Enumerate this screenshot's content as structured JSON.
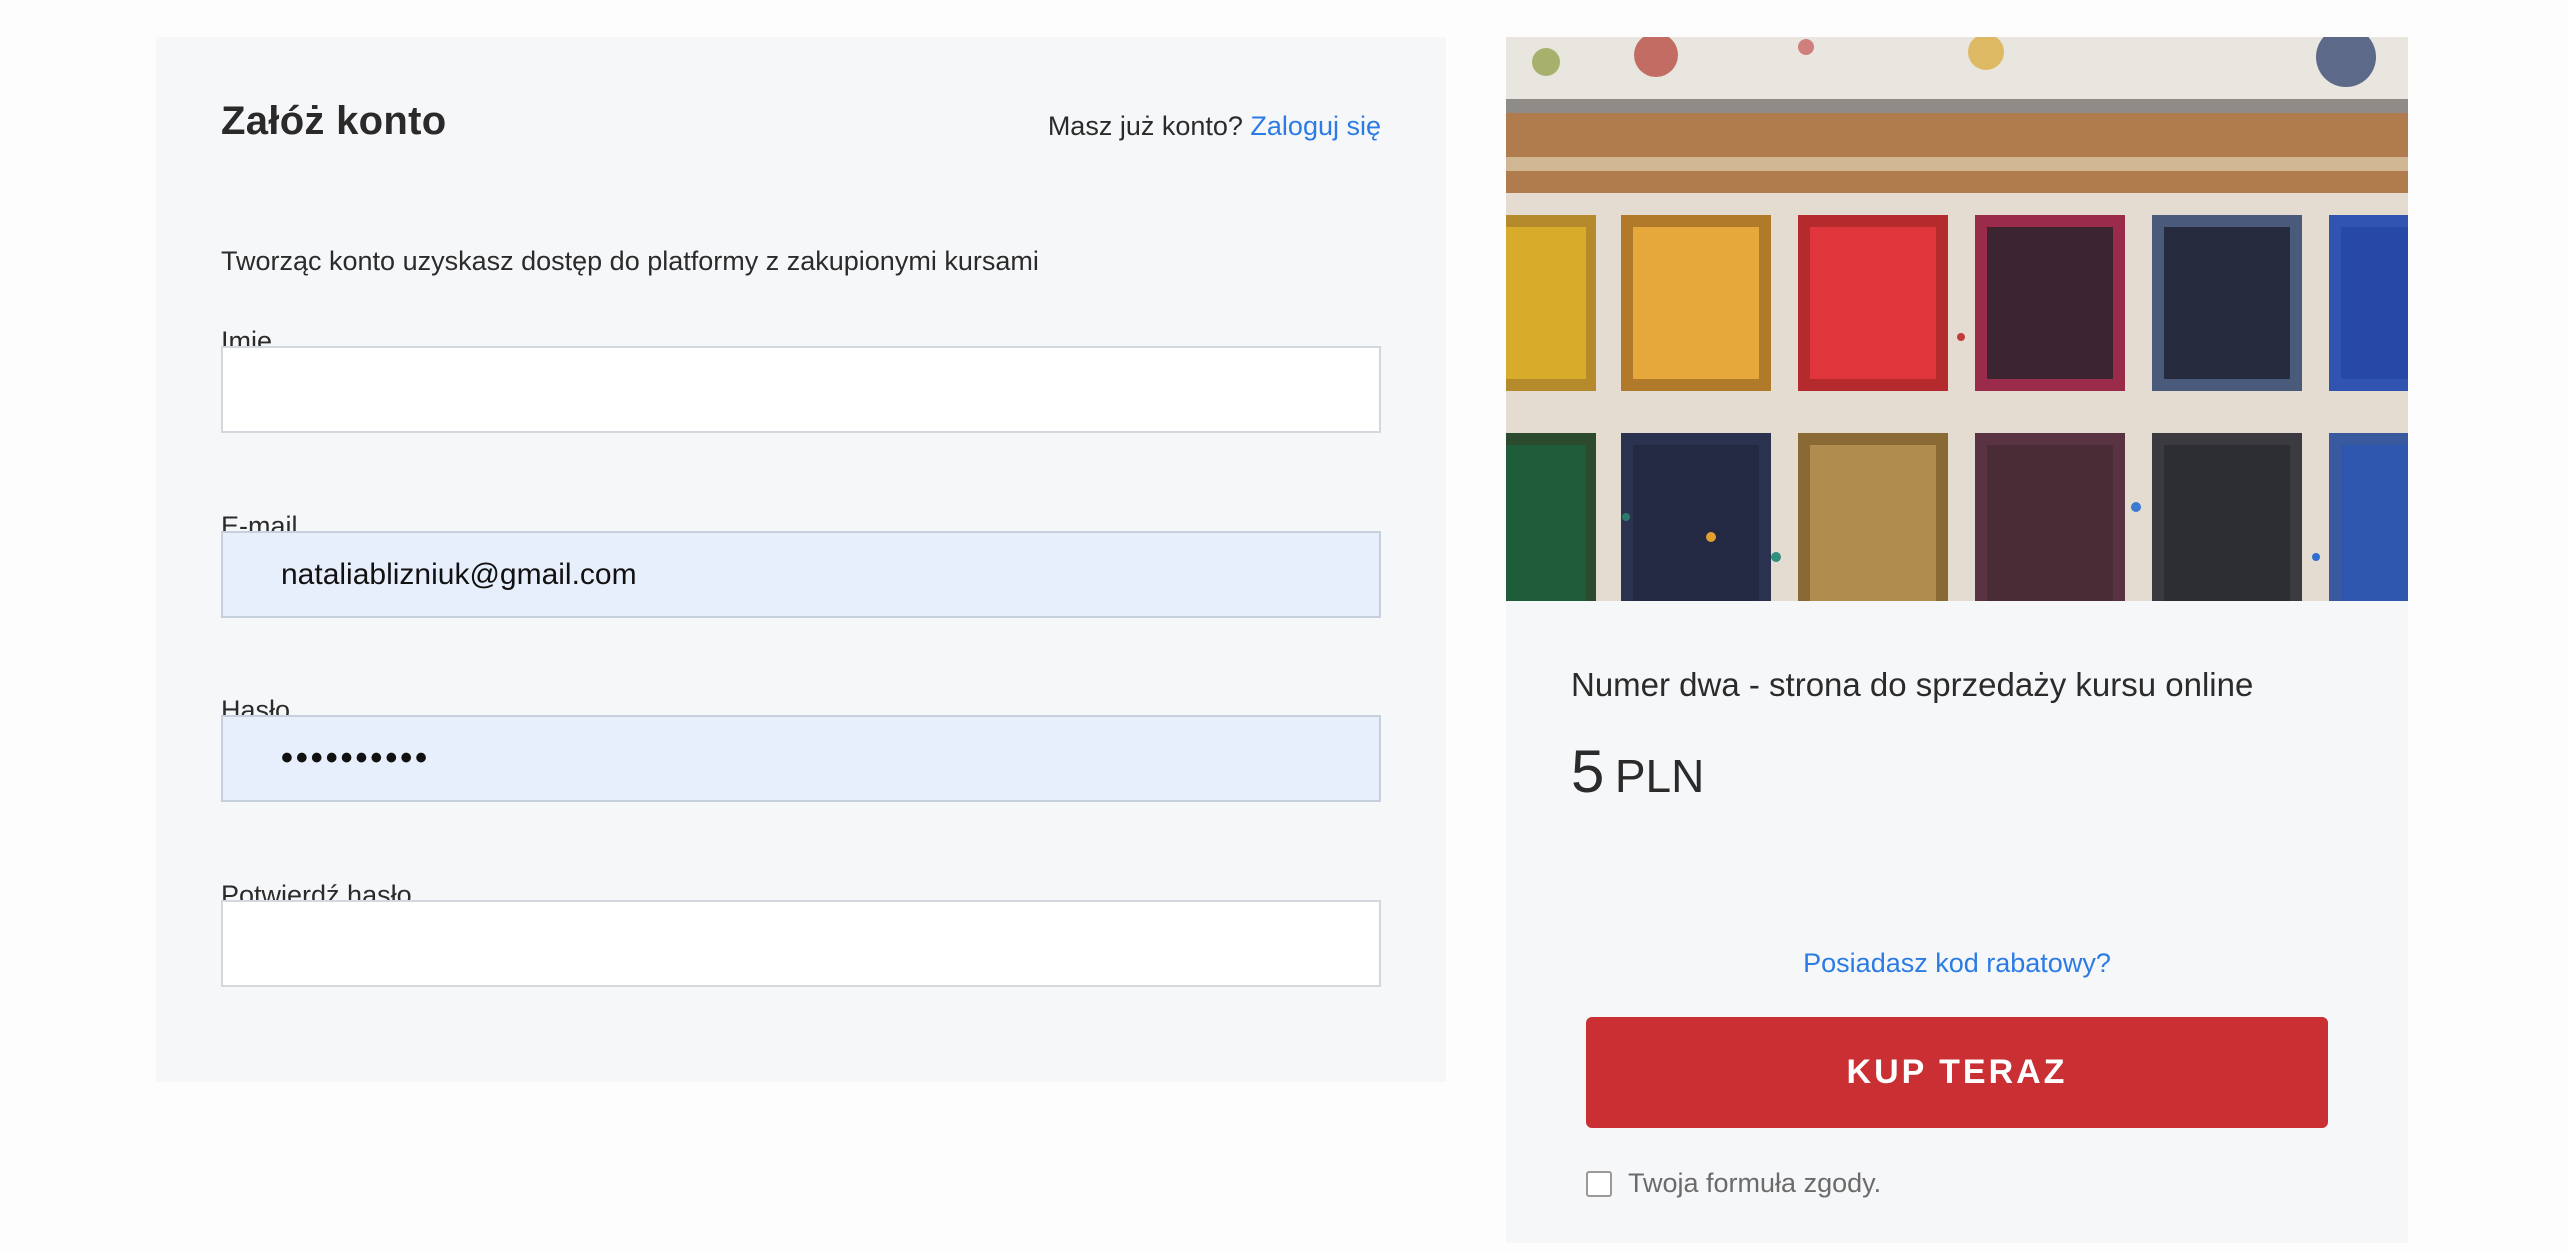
{
  "form": {
    "title": "Załóż konto",
    "login_prompt": "Masz już konto?",
    "login_link": "Zaloguj się",
    "subtitle": "Tworząc konto uzyskasz dostęp do platformy z zakupionymi kursami",
    "fields": {
      "name": {
        "label": "Imię",
        "value": ""
      },
      "email": {
        "label": "E-mail",
        "value": "nataliablizniuk@gmail.com"
      },
      "password": {
        "label": "Hasło",
        "value": "••••••••••"
      },
      "confirm_password": {
        "label": "Potwierdź hasło",
        "value": ""
      }
    }
  },
  "product": {
    "image_icon": "watercolor-palette-image",
    "name": "Numer dwa - strona do sprzedaży kursu online",
    "price_amount": "5",
    "price_currency": "PLN",
    "discount_link": "Posiadasz kod rabatowy?",
    "buy_button": "KUP TERAZ",
    "consent_label": "Twoja formuła zgody.",
    "consent_checked": false
  },
  "colors": {
    "accent_link": "#2c7be5",
    "buy_button": "#c92f33",
    "autofill_bg": "#e8effc",
    "panel_bg": "#f6f7f9"
  }
}
